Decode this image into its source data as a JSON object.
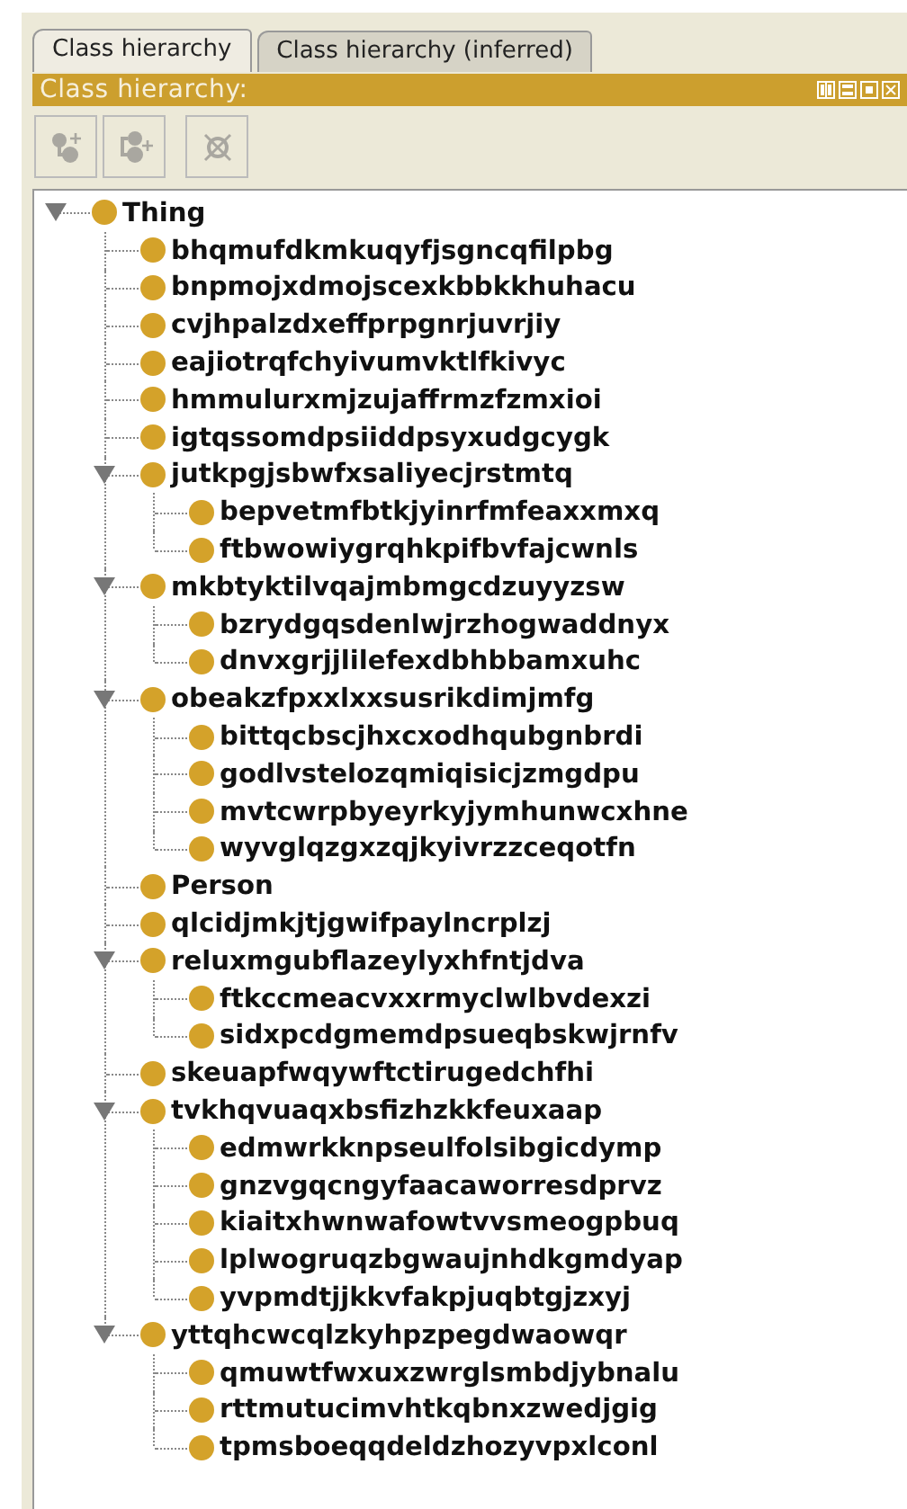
{
  "tabs": [
    {
      "label": "Class hierarchy",
      "selected": true
    },
    {
      "label": "Class hierarchy (inferred)",
      "selected": false
    }
  ],
  "panel": {
    "title": "Class hierarchy:"
  },
  "toolbar": [
    {
      "kind": "add-subclass",
      "disabled": true
    },
    {
      "kind": "add-sibling",
      "disabled": true
    },
    {
      "kind": "delete",
      "disabled": true
    }
  ],
  "tree": [
    {
      "label": "Thing",
      "expanded": true,
      "children": [
        {
          "label": "bhqmufdkmkuqyfjsgncqfilpbg"
        },
        {
          "label": "bnpmojxdmojscexkbbkkhuhacu"
        },
        {
          "label": "cvjhpalzdxeffprpgnrjuvrjiy"
        },
        {
          "label": "eajiotrqfchyivumvktlfkivyc"
        },
        {
          "label": "hmmulurxmjzujaffrmzfzmxioi"
        },
        {
          "label": "igtqssomdpsiiddpsyxudgcygk"
        },
        {
          "label": "jutkpgjsbwfxsaliyecjrstmtq",
          "expanded": true,
          "children": [
            {
              "label": "bepvetmfbtkjyinrfmfeaxxmxq"
            },
            {
              "label": "ftbwowiygrqhkpifbvfajcwnls"
            }
          ]
        },
        {
          "label": "mkbtyktilvqajmbmgcdzuyyzsw",
          "expanded": true,
          "children": [
            {
              "label": "bzrydgqsdenlwjrzhogwaddnyx"
            },
            {
              "label": "dnvxgrjjlilefexdbhbbamxuhc"
            }
          ]
        },
        {
          "label": "obeakzfpxxlxxsusrikdimjmfg",
          "expanded": true,
          "children": [
            {
              "label": "bittqcbscjhxcxodhqubgnbrdi"
            },
            {
              "label": "godlvstelozqmiqisicjzmgdpu"
            },
            {
              "label": "mvtcwrpbyeyrkyjymhunwcxhne"
            },
            {
              "label": "wyvglqzgxzqjkyivrzzceqotfn"
            }
          ]
        },
        {
          "label": "Person"
        },
        {
          "label": "qlcidjmkjtjgwifpaylncrplzj"
        },
        {
          "label": "reluxmgubflazeylyxhfntjdva",
          "expanded": true,
          "children": [
            {
              "label": "ftkccmeacvxxrmyclwlbvdexzi"
            },
            {
              "label": "sidxpcdgmemdpsueqbskwjrnfv"
            }
          ]
        },
        {
          "label": "skeuapfwqywftctirugedchfhi"
        },
        {
          "label": "tvkhqvuaqxbsfizhzkkfeuxaap",
          "expanded": true,
          "children": [
            {
              "label": "edmwrkknpseulfolsibgicdymp"
            },
            {
              "label": "gnzvgqcngyfaacaworresdprvz"
            },
            {
              "label": "kiaitxhwnwafowtvvsmeogpbuq"
            },
            {
              "label": "lplwogruqzbgwaujnhdkgmdyap"
            },
            {
              "label": "yvpmdtjjkkvfakpjuqbtgjzxyj"
            }
          ]
        },
        {
          "label": "yttqhcwcqlzkyhpzpegdwaowqr",
          "expanded": true,
          "children": [
            {
              "label": "qmuwtfwxuxzwrglsmbdjybnalu"
            },
            {
              "label": "rttmutucimvhtkqbnxzwedjgig"
            },
            {
              "label": "tpmsboeqqdeldzhozyvpxlconl"
            }
          ]
        }
      ]
    }
  ]
}
